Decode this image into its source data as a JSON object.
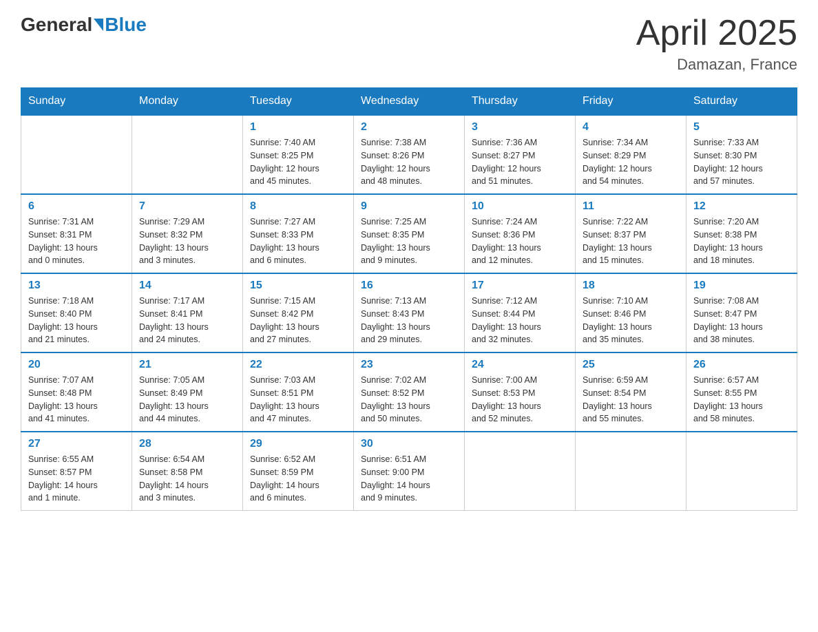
{
  "header": {
    "title": "April 2025",
    "location": "Damazan, France",
    "logo_general": "General",
    "logo_blue": "Blue"
  },
  "days_of_week": [
    "Sunday",
    "Monday",
    "Tuesday",
    "Wednesday",
    "Thursday",
    "Friday",
    "Saturday"
  ],
  "weeks": [
    [
      {
        "day": "",
        "info": ""
      },
      {
        "day": "",
        "info": ""
      },
      {
        "day": "1",
        "info": "Sunrise: 7:40 AM\nSunset: 8:25 PM\nDaylight: 12 hours\nand 45 minutes."
      },
      {
        "day": "2",
        "info": "Sunrise: 7:38 AM\nSunset: 8:26 PM\nDaylight: 12 hours\nand 48 minutes."
      },
      {
        "day": "3",
        "info": "Sunrise: 7:36 AM\nSunset: 8:27 PM\nDaylight: 12 hours\nand 51 minutes."
      },
      {
        "day": "4",
        "info": "Sunrise: 7:34 AM\nSunset: 8:29 PM\nDaylight: 12 hours\nand 54 minutes."
      },
      {
        "day": "5",
        "info": "Sunrise: 7:33 AM\nSunset: 8:30 PM\nDaylight: 12 hours\nand 57 minutes."
      }
    ],
    [
      {
        "day": "6",
        "info": "Sunrise: 7:31 AM\nSunset: 8:31 PM\nDaylight: 13 hours\nand 0 minutes."
      },
      {
        "day": "7",
        "info": "Sunrise: 7:29 AM\nSunset: 8:32 PM\nDaylight: 13 hours\nand 3 minutes."
      },
      {
        "day": "8",
        "info": "Sunrise: 7:27 AM\nSunset: 8:33 PM\nDaylight: 13 hours\nand 6 minutes."
      },
      {
        "day": "9",
        "info": "Sunrise: 7:25 AM\nSunset: 8:35 PM\nDaylight: 13 hours\nand 9 minutes."
      },
      {
        "day": "10",
        "info": "Sunrise: 7:24 AM\nSunset: 8:36 PM\nDaylight: 13 hours\nand 12 minutes."
      },
      {
        "day": "11",
        "info": "Sunrise: 7:22 AM\nSunset: 8:37 PM\nDaylight: 13 hours\nand 15 minutes."
      },
      {
        "day": "12",
        "info": "Sunrise: 7:20 AM\nSunset: 8:38 PM\nDaylight: 13 hours\nand 18 minutes."
      }
    ],
    [
      {
        "day": "13",
        "info": "Sunrise: 7:18 AM\nSunset: 8:40 PM\nDaylight: 13 hours\nand 21 minutes."
      },
      {
        "day": "14",
        "info": "Sunrise: 7:17 AM\nSunset: 8:41 PM\nDaylight: 13 hours\nand 24 minutes."
      },
      {
        "day": "15",
        "info": "Sunrise: 7:15 AM\nSunset: 8:42 PM\nDaylight: 13 hours\nand 27 minutes."
      },
      {
        "day": "16",
        "info": "Sunrise: 7:13 AM\nSunset: 8:43 PM\nDaylight: 13 hours\nand 29 minutes."
      },
      {
        "day": "17",
        "info": "Sunrise: 7:12 AM\nSunset: 8:44 PM\nDaylight: 13 hours\nand 32 minutes."
      },
      {
        "day": "18",
        "info": "Sunrise: 7:10 AM\nSunset: 8:46 PM\nDaylight: 13 hours\nand 35 minutes."
      },
      {
        "day": "19",
        "info": "Sunrise: 7:08 AM\nSunset: 8:47 PM\nDaylight: 13 hours\nand 38 minutes."
      }
    ],
    [
      {
        "day": "20",
        "info": "Sunrise: 7:07 AM\nSunset: 8:48 PM\nDaylight: 13 hours\nand 41 minutes."
      },
      {
        "day": "21",
        "info": "Sunrise: 7:05 AM\nSunset: 8:49 PM\nDaylight: 13 hours\nand 44 minutes."
      },
      {
        "day": "22",
        "info": "Sunrise: 7:03 AM\nSunset: 8:51 PM\nDaylight: 13 hours\nand 47 minutes."
      },
      {
        "day": "23",
        "info": "Sunrise: 7:02 AM\nSunset: 8:52 PM\nDaylight: 13 hours\nand 50 minutes."
      },
      {
        "day": "24",
        "info": "Sunrise: 7:00 AM\nSunset: 8:53 PM\nDaylight: 13 hours\nand 52 minutes."
      },
      {
        "day": "25",
        "info": "Sunrise: 6:59 AM\nSunset: 8:54 PM\nDaylight: 13 hours\nand 55 minutes."
      },
      {
        "day": "26",
        "info": "Sunrise: 6:57 AM\nSunset: 8:55 PM\nDaylight: 13 hours\nand 58 minutes."
      }
    ],
    [
      {
        "day": "27",
        "info": "Sunrise: 6:55 AM\nSunset: 8:57 PM\nDaylight: 14 hours\nand 1 minute."
      },
      {
        "day": "28",
        "info": "Sunrise: 6:54 AM\nSunset: 8:58 PM\nDaylight: 14 hours\nand 3 minutes."
      },
      {
        "day": "29",
        "info": "Sunrise: 6:52 AM\nSunset: 8:59 PM\nDaylight: 14 hours\nand 6 minutes."
      },
      {
        "day": "30",
        "info": "Sunrise: 6:51 AM\nSunset: 9:00 PM\nDaylight: 14 hours\nand 9 minutes."
      },
      {
        "day": "",
        "info": ""
      },
      {
        "day": "",
        "info": ""
      },
      {
        "day": "",
        "info": ""
      }
    ]
  ]
}
